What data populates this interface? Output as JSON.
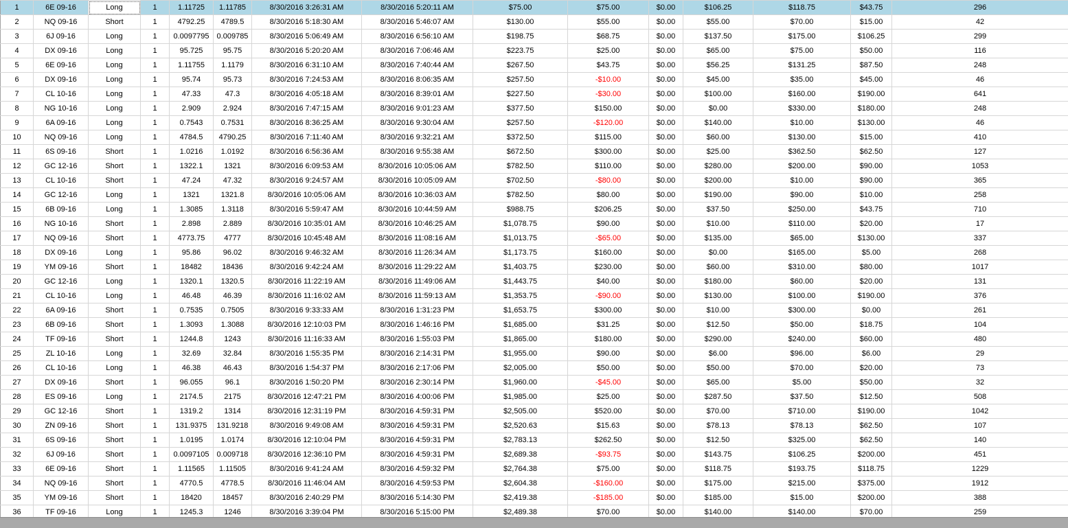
{
  "colors": {
    "selected_row": "#aed7e6",
    "negative": "#ff0000",
    "scrollbar": "#a9a9a9"
  },
  "rows": [
    [
      "1",
      "6E 09-16",
      "Long",
      "1",
      "1.11725",
      "1.11785",
      "8/30/2016 3:26:31 AM",
      "8/30/2016 5:20:11 AM",
      "$75.00",
      "$75.00",
      "$0.00",
      "$106.25",
      "$118.75",
      "$43.75",
      "296"
    ],
    [
      "2",
      "NQ 09-16",
      "Short",
      "1",
      "4792.25",
      "4789.5",
      "8/30/2016 5:18:30 AM",
      "8/30/2016 5:46:07 AM",
      "$130.00",
      "$55.00",
      "$0.00",
      "$55.00",
      "$70.00",
      "$15.00",
      "42"
    ],
    [
      "3",
      "6J 09-16",
      "Long",
      "1",
      "0.0097795",
      "0.009785",
      "8/30/2016 5:06:49 AM",
      "8/30/2016 6:56:10 AM",
      "$198.75",
      "$68.75",
      "$0.00",
      "$137.50",
      "$175.00",
      "$106.25",
      "299"
    ],
    [
      "4",
      "DX 09-16",
      "Long",
      "1",
      "95.725",
      "95.75",
      "8/30/2016 5:20:20 AM",
      "8/30/2016 7:06:46 AM",
      "$223.75",
      "$25.00",
      "$0.00",
      "$65.00",
      "$75.00",
      "$50.00",
      "116"
    ],
    [
      "5",
      "6E 09-16",
      "Long",
      "1",
      "1.11755",
      "1.1179",
      "8/30/2016 6:31:10 AM",
      "8/30/2016 7:40:44 AM",
      "$267.50",
      "$43.75",
      "$0.00",
      "$56.25",
      "$131.25",
      "$87.50",
      "248"
    ],
    [
      "6",
      "DX 09-16",
      "Long",
      "1",
      "95.74",
      "95.73",
      "8/30/2016 7:24:53 AM",
      "8/30/2016 8:06:35 AM",
      "$257.50",
      "-$10.00",
      "$0.00",
      "$45.00",
      "$35.00",
      "$45.00",
      "46"
    ],
    [
      "7",
      "CL 10-16",
      "Long",
      "1",
      "47.33",
      "47.3",
      "8/30/2016 4:05:18 AM",
      "8/30/2016 8:39:01 AM",
      "$227.50",
      "-$30.00",
      "$0.00",
      "$100.00",
      "$160.00",
      "$190.00",
      "641"
    ],
    [
      "8",
      "NG 10-16",
      "Long",
      "1",
      "2.909",
      "2.924",
      "8/30/2016 7:47:15 AM",
      "8/30/2016 9:01:23 AM",
      "$377.50",
      "$150.00",
      "$0.00",
      "$0.00",
      "$330.00",
      "$180.00",
      "248"
    ],
    [
      "9",
      "6A 09-16",
      "Long",
      "1",
      "0.7543",
      "0.7531",
      "8/30/2016 8:36:25 AM",
      "8/30/2016 9:30:04 AM",
      "$257.50",
      "-$120.00",
      "$0.00",
      "$140.00",
      "$10.00",
      "$130.00",
      "46"
    ],
    [
      "10",
      "NQ 09-16",
      "Long",
      "1",
      "4784.5",
      "4790.25",
      "8/30/2016 7:11:40 AM",
      "8/30/2016 9:32:21 AM",
      "$372.50",
      "$115.00",
      "$0.00",
      "$60.00",
      "$130.00",
      "$15.00",
      "410"
    ],
    [
      "11",
      "6S 09-16",
      "Short",
      "1",
      "1.0216",
      "1.0192",
      "8/30/2016 6:56:36 AM",
      "8/30/2016 9:55:38 AM",
      "$672.50",
      "$300.00",
      "$0.00",
      "$25.00",
      "$362.50",
      "$62.50",
      "127"
    ],
    [
      "12",
      "GC 12-16",
      "Short",
      "1",
      "1322.1",
      "1321",
      "8/30/2016 6:09:53 AM",
      "8/30/2016 10:05:06 AM",
      "$782.50",
      "$110.00",
      "$0.00",
      "$280.00",
      "$200.00",
      "$90.00",
      "1053"
    ],
    [
      "13",
      "CL 10-16",
      "Short",
      "1",
      "47.24",
      "47.32",
      "8/30/2016 9:24:57 AM",
      "8/30/2016 10:05:09 AM",
      "$702.50",
      "-$80.00",
      "$0.00",
      "$200.00",
      "$10.00",
      "$90.00",
      "365"
    ],
    [
      "14",
      "GC 12-16",
      "Long",
      "1",
      "1321",
      "1321.8",
      "8/30/2016 10:05:06 AM",
      "8/30/2016 10:36:03 AM",
      "$782.50",
      "$80.00",
      "$0.00",
      "$190.00",
      "$90.00",
      "$10.00",
      "258"
    ],
    [
      "15",
      "6B 09-16",
      "Long",
      "1",
      "1.3085",
      "1.3118",
      "8/30/2016 5:59:47 AM",
      "8/30/2016 10:44:59 AM",
      "$988.75",
      "$206.25",
      "$0.00",
      "$37.50",
      "$250.00",
      "$43.75",
      "710"
    ],
    [
      "16",
      "NG 10-16",
      "Short",
      "1",
      "2.898",
      "2.889",
      "8/30/2016 10:35:01 AM",
      "8/30/2016 10:46:25 AM",
      "$1,078.75",
      "$90.00",
      "$0.00",
      "$10.00",
      "$110.00",
      "$20.00",
      "17"
    ],
    [
      "17",
      "NQ 09-16",
      "Short",
      "1",
      "4773.75",
      "4777",
      "8/30/2016 10:45:48 AM",
      "8/30/2016 11:08:16 AM",
      "$1,013.75",
      "-$65.00",
      "$0.00",
      "$135.00",
      "$65.00",
      "$130.00",
      "337"
    ],
    [
      "18",
      "DX 09-16",
      "Long",
      "1",
      "95.86",
      "96.02",
      "8/30/2016 9:46:32 AM",
      "8/30/2016 11:26:34 AM",
      "$1,173.75",
      "$160.00",
      "$0.00",
      "$0.00",
      "$165.00",
      "$5.00",
      "268"
    ],
    [
      "19",
      "YM 09-16",
      "Short",
      "1",
      "18482",
      "18436",
      "8/30/2016 9:42:24 AM",
      "8/30/2016 11:29:22 AM",
      "$1,403.75",
      "$230.00",
      "$0.00",
      "$60.00",
      "$310.00",
      "$80.00",
      "1017"
    ],
    [
      "20",
      "GC 12-16",
      "Long",
      "1",
      "1320.1",
      "1320.5",
      "8/30/2016 11:22:19 AM",
      "8/30/2016 11:49:06 AM",
      "$1,443.75",
      "$40.00",
      "$0.00",
      "$180.00",
      "$60.00",
      "$20.00",
      "131"
    ],
    [
      "21",
      "CL 10-16",
      "Long",
      "1",
      "46.48",
      "46.39",
      "8/30/2016 11:16:02 AM",
      "8/30/2016 11:59:13 AM",
      "$1,353.75",
      "-$90.00",
      "$0.00",
      "$130.00",
      "$100.00",
      "$190.00",
      "376"
    ],
    [
      "22",
      "6A 09-16",
      "Short",
      "1",
      "0.7535",
      "0.7505",
      "8/30/2016 9:33:33 AM",
      "8/30/2016 1:31:23 PM",
      "$1,653.75",
      "$300.00",
      "$0.00",
      "$10.00",
      "$300.00",
      "$0.00",
      "261"
    ],
    [
      "23",
      "6B 09-16",
      "Short",
      "1",
      "1.3093",
      "1.3088",
      "8/30/2016 12:10:03 PM",
      "8/30/2016 1:46:16 PM",
      "$1,685.00",
      "$31.25",
      "$0.00",
      "$12.50",
      "$50.00",
      "$18.75",
      "104"
    ],
    [
      "24",
      "TF 09-16",
      "Short",
      "1",
      "1244.8",
      "1243",
      "8/30/2016 11:16:33 AM",
      "8/30/2016 1:55:03 PM",
      "$1,865.00",
      "$180.00",
      "$0.00",
      "$290.00",
      "$240.00",
      "$60.00",
      "480"
    ],
    [
      "25",
      "ZL 10-16",
      "Long",
      "1",
      "32.69",
      "32.84",
      "8/30/2016 1:55:35 PM",
      "8/30/2016 2:14:31 PM",
      "$1,955.00",
      "$90.00",
      "$0.00",
      "$6.00",
      "$96.00",
      "$6.00",
      "29"
    ],
    [
      "26",
      "CL 10-16",
      "Long",
      "1",
      "46.38",
      "46.43",
      "8/30/2016 1:54:37 PM",
      "8/30/2016 2:17:06 PM",
      "$2,005.00",
      "$50.00",
      "$0.00",
      "$50.00",
      "$70.00",
      "$20.00",
      "73"
    ],
    [
      "27",
      "DX 09-16",
      "Short",
      "1",
      "96.055",
      "96.1",
      "8/30/2016 1:50:20 PM",
      "8/30/2016 2:30:14 PM",
      "$1,960.00",
      "-$45.00",
      "$0.00",
      "$65.00",
      "$5.00",
      "$50.00",
      "32"
    ],
    [
      "28",
      "ES 09-16",
      "Long",
      "1",
      "2174.5",
      "2175",
      "8/30/2016 12:47:21 PM",
      "8/30/2016 4:00:06 PM",
      "$1,985.00",
      "$25.00",
      "$0.00",
      "$287.50",
      "$37.50",
      "$12.50",
      "508"
    ],
    [
      "29",
      "GC 12-16",
      "Short",
      "1",
      "1319.2",
      "1314",
      "8/30/2016 12:31:19 PM",
      "8/30/2016 4:59:31 PM",
      "$2,505.00",
      "$520.00",
      "$0.00",
      "$70.00",
      "$710.00",
      "$190.00",
      "1042"
    ],
    [
      "30",
      "ZN 09-16",
      "Short",
      "1",
      "131.9375",
      "131.9218",
      "8/30/2016 9:49:08 AM",
      "8/30/2016 4:59:31 PM",
      "$2,520.63",
      "$15.63",
      "$0.00",
      "$78.13",
      "$78.13",
      "$62.50",
      "107"
    ],
    [
      "31",
      "6S 09-16",
      "Short",
      "1",
      "1.0195",
      "1.0174",
      "8/30/2016 12:10:04 PM",
      "8/30/2016 4:59:31 PM",
      "$2,783.13",
      "$262.50",
      "$0.00",
      "$12.50",
      "$325.00",
      "$62.50",
      "140"
    ],
    [
      "32",
      "6J 09-16",
      "Short",
      "1",
      "0.0097105",
      "0.009718",
      "8/30/2016 12:36:10 PM",
      "8/30/2016 4:59:31 PM",
      "$2,689.38",
      "-$93.75",
      "$0.00",
      "$143.75",
      "$106.25",
      "$200.00",
      "451"
    ],
    [
      "33",
      "6E 09-16",
      "Short",
      "1",
      "1.11565",
      "1.11505",
      "8/30/2016 9:41:24 AM",
      "8/30/2016 4:59:32 PM",
      "$2,764.38",
      "$75.00",
      "$0.00",
      "$118.75",
      "$193.75",
      "$118.75",
      "1229"
    ],
    [
      "34",
      "NQ 09-16",
      "Short",
      "1",
      "4770.5",
      "4778.5",
      "8/30/2016 11:46:04 AM",
      "8/30/2016 4:59:53 PM",
      "$2,604.38",
      "-$160.00",
      "$0.00",
      "$175.00",
      "$215.00",
      "$375.00",
      "1912"
    ],
    [
      "35",
      "YM 09-16",
      "Short",
      "1",
      "18420",
      "18457",
      "8/30/2016 2:40:29 PM",
      "8/30/2016 5:14:30 PM",
      "$2,419.38",
      "-$185.00",
      "$0.00",
      "$185.00",
      "$15.00",
      "$200.00",
      "388"
    ],
    [
      "36",
      "TF 09-16",
      "Long",
      "1",
      "1245.3",
      "1246",
      "8/30/2016 3:39:04 PM",
      "8/30/2016 5:15:00 PM",
      "$2,489.38",
      "$70.00",
      "$0.00",
      "$140.00",
      "$140.00",
      "$70.00",
      "259"
    ]
  ],
  "selected_row": 0
}
